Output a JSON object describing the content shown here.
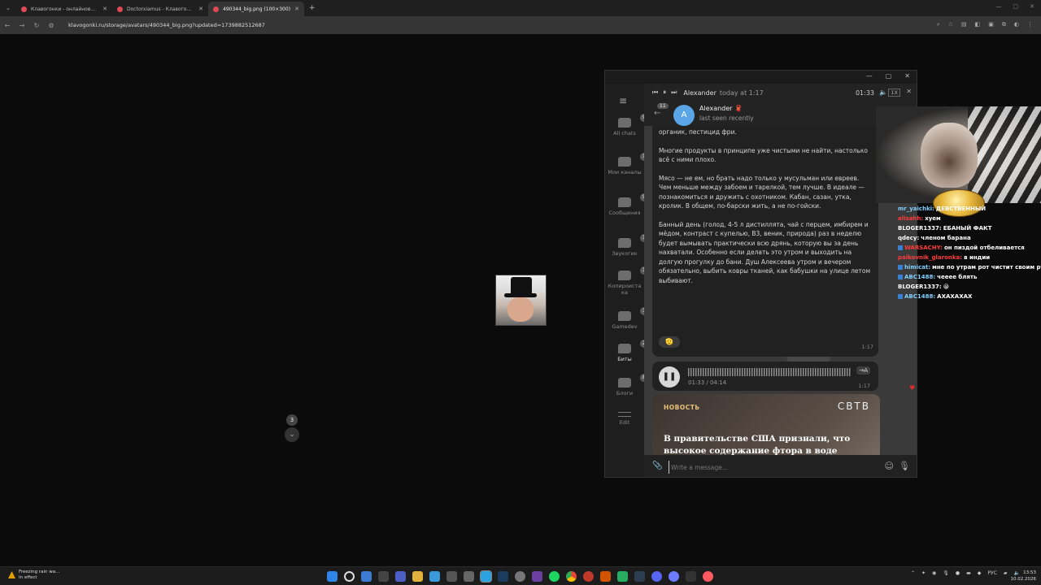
{
  "browser": {
    "tabs": [
      {
        "title": "Клавогонки - онлайновый кл..."
      },
      {
        "title": "Doctorxiamus - Клавогонки"
      },
      {
        "title": "490344_big.png (100×300)"
      }
    ],
    "url": "klavogonki.ru/storage/avatars/490344_big.png?updated=1739882512687"
  },
  "telegram": {
    "sidebar": [
      {
        "label": "All chats",
        "badge": "99+"
      },
      {
        "label": "Мои каналы",
        "badge": "1"
      },
      {
        "label": "Сообщения",
        "badge": "99+"
      },
      {
        "label": "Звукогик",
        "badge": "13"
      },
      {
        "label": "Копироиста ка",
        "badge": "17"
      },
      {
        "label": "Gamedev",
        "badge": "3"
      },
      {
        "label": "Биты",
        "badge": "25"
      },
      {
        "label": "Блоги",
        "badge": "8"
      },
      {
        "label": "Edit",
        "badge": ""
      }
    ],
    "player": {
      "title": "Alexander",
      "time_label": "today at 1:17",
      "position": "01:33",
      "speed": "1X"
    },
    "header": {
      "unread": "11",
      "avatar_letter": "A",
      "name": "Alexander 🧣",
      "status": "last seen recently"
    },
    "message": {
      "paragraphs": [
        "органик, пестицид фри.",
        "Многие продукты в принципе уже чистыми не найти, настолько всё с ними плохо.",
        "Мясо — не ем, но брать надо только у мусульман или евреев. Чем меньше между забоем и тарелкой, тем лучше. В идеале — познакомиться и дружить с охотником. Кабан, сазан, утка, кролик. В общем, по-барски жить, а не по-гойски.",
        "Банный день (голод, 4-5 л дистиллята, чай с перцем, имбирем и мёдом, контраст с купелью, B3, веник, природа) раз в неделю будет вымывать практически всю дрянь, которую вы за день нахватали. Особенно если делать это утром и выходить на долгую прогулку до бани. Душ Алексеева утром и вечером обязательно, выбить ковры тканей, как бабушки на улице летом выбивают."
      ],
      "reaction": "🫡",
      "time": "1:17"
    },
    "voice": {
      "progress": "01:33 / 04:14",
      "transcribe_label": "→A",
      "time": "1:17",
      "heart": "♥"
    },
    "news": {
      "tag": "НОВОСТЬ",
      "logo": "СВТВ",
      "headline": "В правительстве США признали, что высокое содержание фтора в воде снижает IQ у детей. Американскую воду фторируют с прошлого века"
    },
    "scroll_badge": "3",
    "compose": {
      "placeholder": "Write a message..."
    }
  },
  "overlay_chat": [
    {
      "user": "mr_yaichki:",
      "text": "ДЕВСТВЕННЫЙ",
      "color": "#7fd0ff",
      "badge": false
    },
    {
      "user": "alisahh:",
      "text": "хуем",
      "color": "#ff3b3b",
      "badge": false
    },
    {
      "user": "BLOGER1337:",
      "text": "ЕБАНЫЙ ФАКТ",
      "color": "#ffffff",
      "badge": false
    },
    {
      "user": "qdecy:",
      "text": "членом барана",
      "color": "#ffffff",
      "badge": false
    },
    {
      "user": "WARSACHY:",
      "text": "он пиздой отбеливается",
      "color": "#ff3b3b",
      "badge": true
    },
    {
      "user": "paikovnik_glaronka:",
      "text": "в индии",
      "color": "#ff3b3b",
      "badge": false
    },
    {
      "user": "himicat:",
      "text": "мне по утрам рот чистит своим ртом вика",
      "color": "#7fd0ff",
      "badge": true
    },
    {
      "user": "ABC1488:",
      "text": "чееее блять",
      "color": "#7fd0ff",
      "badge": true
    },
    {
      "user": "BLOGER1337:",
      "text": "😀",
      "color": "#ffffff",
      "badge": false
    },
    {
      "user": "ABC1488:",
      "text": "АХАХАХАХ",
      "color": "#7fd0ff",
      "badge": true
    }
  ],
  "taskbar": {
    "weather_title": "Freezing rain wa...",
    "weather_sub": "In effect",
    "lang": "РУС",
    "time": "13:53",
    "date": "10.02.2026"
  }
}
